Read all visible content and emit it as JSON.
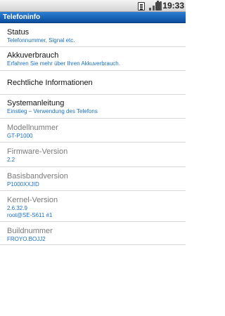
{
  "statusbar": {
    "time": "19:33"
  },
  "title": "Telefoninfo",
  "items": [
    {
      "title": "Status",
      "subtitle": "Telefonnummer, Signal etc."
    },
    {
      "title": "Akkuverbrauch",
      "subtitle": "Erfahren Sie mehr über Ihren Akkuverbrauch."
    },
    {
      "title": "Rechtliche Informationen"
    },
    {
      "title": "Systemanleitung",
      "subtitle": "Einstieg – Verwendung des Telefons"
    },
    {
      "title": "Modellnummer",
      "subtitle": "GT-P1000"
    },
    {
      "title": "Firmware-Version",
      "subtitle": "2.2"
    },
    {
      "title": "Basisbandversion",
      "subtitle": "P1000XXJID"
    },
    {
      "title": "Kernel-Version",
      "subtitle": "2.6.32.9",
      "subtitle2": "root@SE-S611 #1"
    },
    {
      "title": "Buildnummer",
      "subtitle": "FROYO.BOJJ2"
    }
  ]
}
